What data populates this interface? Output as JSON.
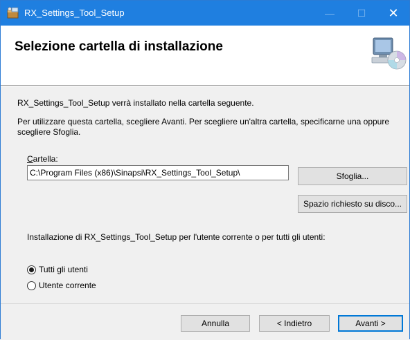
{
  "window": {
    "title": "RX_Settings_Tool_Setup",
    "controls": {
      "minimize": "—",
      "maximize": "☐",
      "close": "✕"
    },
    "accent_color": "#1f7fe0",
    "title_icon": "installer-package-icon"
  },
  "header": {
    "title": "Selezione cartella di installazione",
    "icon": "computer-cd-icon"
  },
  "body": {
    "intro": "RX_Settings_Tool_Setup verrà installato nella cartella seguente.",
    "instructions": "Per utilizzare questa cartella, scegliere Avanti. Per scegliere un'altra cartella, specificarne una oppure scegliere Sfoglia.",
    "folder_label_first": "C",
    "folder_label_rest": "artella:",
    "folder_path": "C:\\Program Files (x86)\\Sinapsi\\RX_Settings_Tool_Setup\\",
    "browse_label": "Sfoglia...",
    "disk_space_label": "Spazio richiesto su disco...",
    "scope_question": "Installazione di RX_Settings_Tool_Setup per l'utente corrente o per tutti gli utenti:",
    "options": [
      {
        "label": "Tutti gli utenti",
        "selected": true
      },
      {
        "label": "Utente corrente",
        "selected": false
      }
    ]
  },
  "footer": {
    "cancel_label": "Annulla",
    "back_label": "< Indietro",
    "next_label": "Avanti >"
  }
}
